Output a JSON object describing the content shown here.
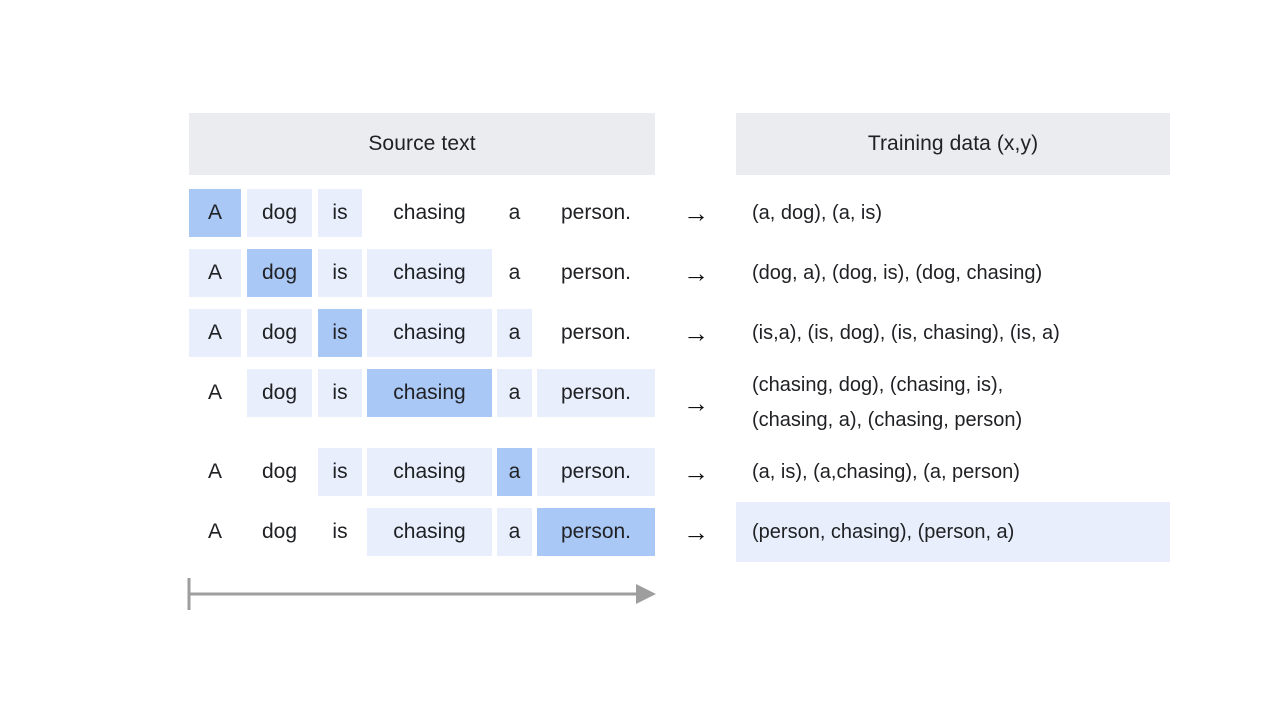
{
  "columns": {
    "source_header": "Source text",
    "training_header": "Training data (x,y)"
  },
  "tokens": [
    "A",
    "dog",
    "is",
    "chasing",
    "a",
    "person."
  ],
  "rows": [
    {
      "highlights": [
        "dark",
        "light",
        "light",
        "none",
        "none",
        "none"
      ],
      "arrow": "→",
      "training": "(a, dog), (a, is)",
      "band": false
    },
    {
      "highlights": [
        "light",
        "dark",
        "light",
        "light",
        "none",
        "none"
      ],
      "arrow": "→",
      "training": "(dog, a), (dog, is), (dog, chasing)",
      "band": false
    },
    {
      "highlights": [
        "light",
        "light",
        "dark",
        "light",
        "light",
        "none"
      ],
      "arrow": "→",
      "training": "(is,a), (is, dog), (is, chasing), (is, a)",
      "band": false
    },
    {
      "highlights": [
        "none",
        "light",
        "light",
        "dark",
        "light",
        "light"
      ],
      "arrow": "→",
      "training": "(chasing, dog), (chasing, is),\n(chasing, a), (chasing, person)",
      "band": false
    },
    {
      "highlights": [
        "none",
        "none",
        "light",
        "light",
        "dark",
        "light"
      ],
      "arrow": "→",
      "training": "(a, is), (a,chasing), (a, person)",
      "band": false
    },
    {
      "highlights": [
        "none",
        "none",
        "none",
        "light",
        "light",
        "dark"
      ],
      "arrow": "→",
      "training": "(person, chasing), (person, a)",
      "band": true
    }
  ],
  "bottom_arrow": {
    "name": "sliding-window-direction-arrow",
    "color": "#9e9e9e"
  },
  "colors": {
    "header_bg": "#ebecf0",
    "highlight_light": "#e8eefc",
    "highlight_dark": "#aac8f5",
    "text": "#202124",
    "page_bg": "#ffffff"
  }
}
